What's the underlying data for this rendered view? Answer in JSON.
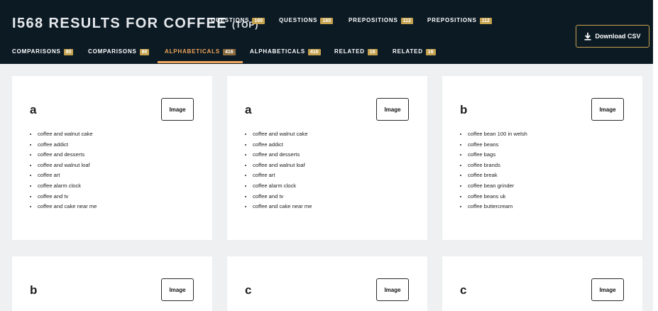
{
  "header": {
    "title_main": "I568 RESULTS FOR COFFEE",
    "title_sub": "(TOP)",
    "download_label": "Download CSV"
  },
  "tabs_top": [
    {
      "label": "QUESTIONS",
      "count": "160"
    },
    {
      "label": "QUESTIONS",
      "count": "160"
    },
    {
      "label": "PREPOSITIONS",
      "count": "112"
    },
    {
      "label": "PREPOSITIONS",
      "count": "112"
    }
  ],
  "tabs_bottom": [
    {
      "label": "COMPARISONS",
      "count": "80"
    },
    {
      "label": "COMPARISONS",
      "count": "80"
    },
    {
      "label": "ALPHABETICALS",
      "count": "416"
    },
    {
      "label": "ALPHABETICALS",
      "count": "416"
    },
    {
      "label": "RELATED",
      "count": "16"
    },
    {
      "label": "RELATED",
      "count": "16"
    }
  ],
  "active_tab": "ALPHABETICALS",
  "colors": {
    "header_bg": "#0c1a24",
    "accent": "#f0a65a",
    "badge": "#c5a24e"
  },
  "cards": [
    {
      "letter": "a",
      "button": "Image",
      "items": [
        "coffee and walnut cake",
        "coffee addict",
        "coffee and desserts",
        "coffee and walnut loaf",
        "coffee art",
        "coffee alarm clock",
        "coffee and tv",
        "coffee and cake near me"
      ]
    },
    {
      "letter": "a",
      "button": "Image",
      "items": [
        "coffee and walnut cake",
        "coffee addict",
        "coffee and desserts",
        "coffee and walnut loaf",
        "coffee art",
        "coffee alarm clock",
        "coffee and tv",
        "coffee and cake near me"
      ]
    },
    {
      "letter": "b",
      "button": "Image",
      "items": [
        "coffee bean 100 in welsh",
        "coffee beans",
        "coffee bags",
        "coffee brands",
        "coffee break",
        "coffee bean grinder",
        "coffee beans uk",
        "coffee buttercream"
      ]
    },
    {
      "letter": "b",
      "button": "Image",
      "items": []
    },
    {
      "letter": "c",
      "button": "Image",
      "items": []
    },
    {
      "letter": "c",
      "button": "Image",
      "items": []
    }
  ]
}
